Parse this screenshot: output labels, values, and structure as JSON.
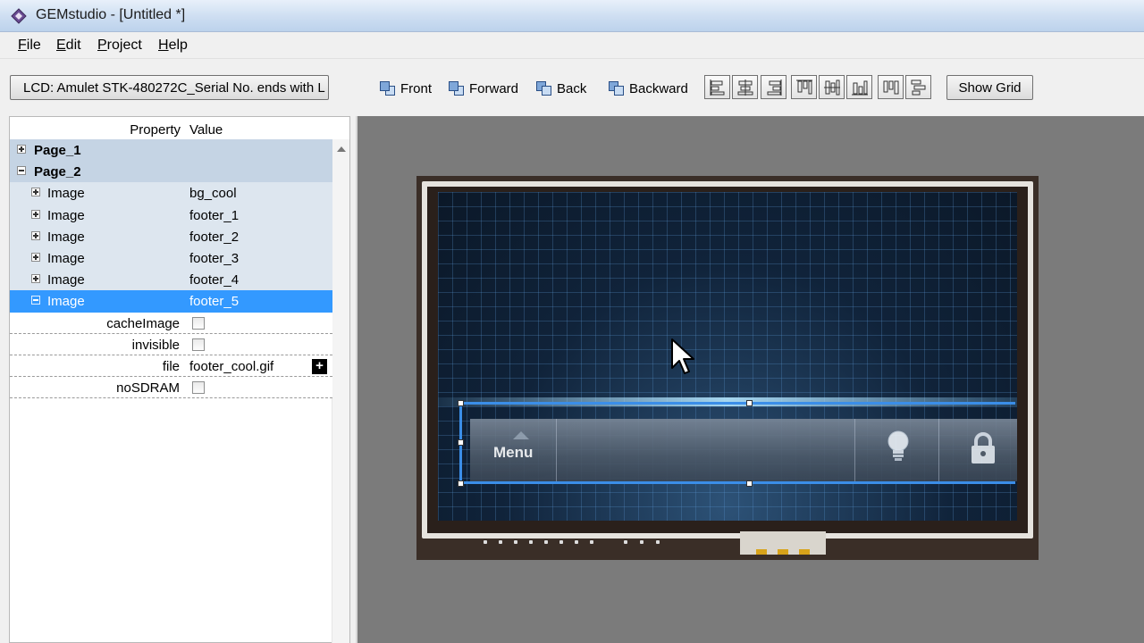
{
  "window": {
    "title": "GEMstudio - [Untitled *]"
  },
  "menu": [
    {
      "label": "File",
      "u": "F",
      "rest": "ile"
    },
    {
      "label": "Edit",
      "u": "E",
      "rest": "dit"
    },
    {
      "label": "Project",
      "u": "P",
      "rest": "roject"
    },
    {
      "label": "Help",
      "u": "H",
      "rest": "elp"
    }
  ],
  "toolbar": {
    "lcd_label": "LCD: Amulet STK-480272C_Serial No. ends with L",
    "front": "Front",
    "forward": "Forward",
    "back": "Back",
    "backward": "Backward",
    "show_grid": "Show Grid"
  },
  "properties": {
    "header_property": "Property",
    "header_value": "Value",
    "page1": "Page_1",
    "page2": "Page_2",
    "images": [
      {
        "label": "Image",
        "value": "bg_cool"
      },
      {
        "label": "Image",
        "value": "footer_1"
      },
      {
        "label": "Image",
        "value": "footer_2"
      },
      {
        "label": "Image",
        "value": "footer_3"
      },
      {
        "label": "Image",
        "value": "footer_4"
      },
      {
        "label": "Image",
        "value": "footer_5"
      }
    ],
    "fields": {
      "cache_image": "cacheImage",
      "invisible": "invisible",
      "file": "file",
      "file_value": "footer_cool.gif",
      "no_sdram": "noSDRAM",
      "plus": "+"
    }
  },
  "lcd": {
    "menu_label": "Menu"
  }
}
